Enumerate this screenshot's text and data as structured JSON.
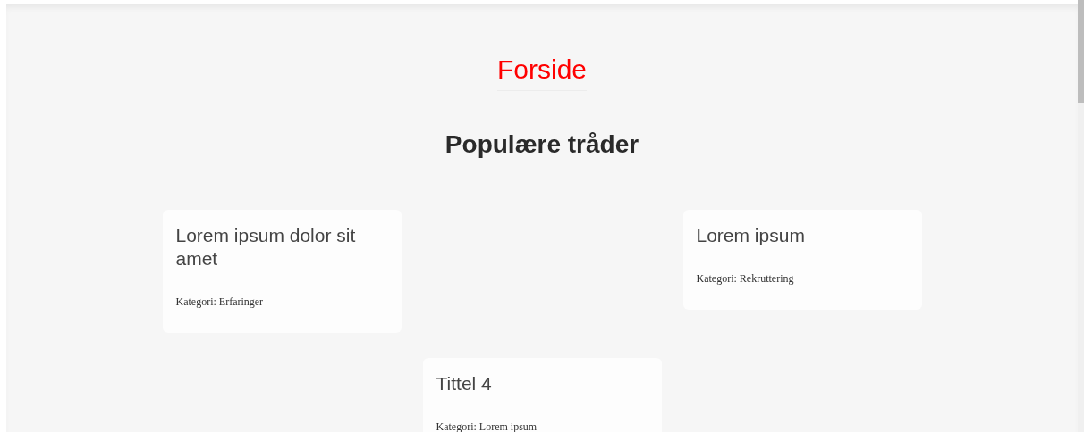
{
  "page_title": "Forside",
  "section_heading": "Populære tråder",
  "threads": [
    {
      "title": "Lorem ipsum dolor sit amet",
      "category": "Kategori: Erfaringer"
    },
    {
      "title": "Lorem ipsum",
      "category": "Kategori: Rekruttering"
    },
    {
      "title": "Tittel 4",
      "category": "Kategori: Lorem ipsum"
    }
  ]
}
